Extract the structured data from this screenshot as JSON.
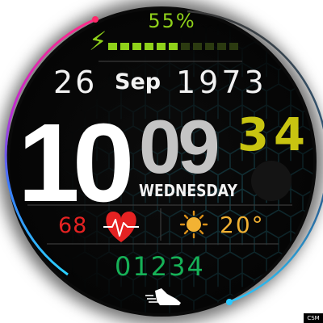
{
  "battery": {
    "percent_text": "55%",
    "level": 0.55,
    "segments_total": 11,
    "segments_filled": 6,
    "color": "#8fd11a",
    "icon": "lightning-bolt-icon"
  },
  "date": {
    "day": "26",
    "month": "Sep",
    "year": "1973"
  },
  "time": {
    "hour": "10",
    "minute": "09",
    "second": "34"
  },
  "weekday": "WEDNESDAY",
  "health": {
    "heart_rate": "68",
    "heart_rate_color": "#e52222",
    "icon": "heart-pulse-icon"
  },
  "weather": {
    "temperature": "20°",
    "temperature_color": "#f2b233",
    "icon": "sun-icon"
  },
  "activity": {
    "steps": "01234",
    "steps_color": "#16b157",
    "icon": "running-shoe-icon"
  },
  "watermark": "CSM"
}
